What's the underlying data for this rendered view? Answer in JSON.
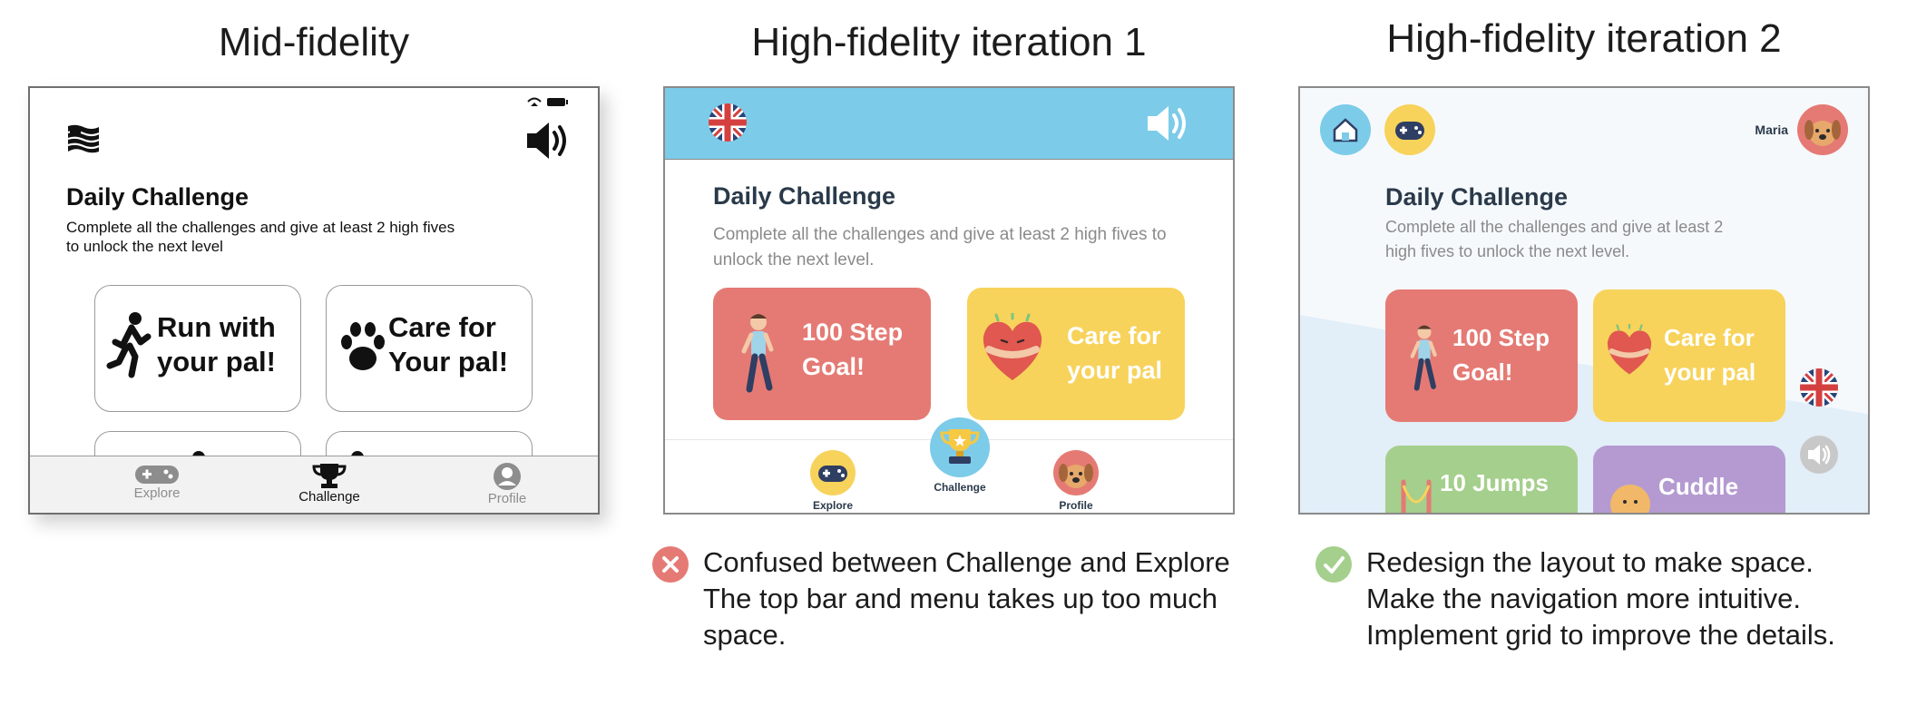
{
  "titles": {
    "mid": "Mid-fidelity",
    "hf1": "High-fidelity iteration 1",
    "hf2": "High-fidelity iteration 2"
  },
  "mid": {
    "heading": "Daily Challenge",
    "description": "Complete all the challenges and give at least 2 high fives to unlock the next level",
    "cards": [
      {
        "label": "Run with your pal!",
        "icon": "running-person-icon"
      },
      {
        "label": "Care for Your pal!",
        "icon": "paw-icon"
      }
    ],
    "nav": [
      {
        "label": "Explore",
        "icon": "gamepad-icon",
        "active": false
      },
      {
        "label": "Challenge",
        "icon": "trophy-icon",
        "active": true
      },
      {
        "label": "Profile",
        "icon": "user-icon",
        "active": false
      }
    ]
  },
  "hf1": {
    "heading": "Daily Challenge",
    "description": "Complete all the challenges and give at least 2 high fives to unlock the next level.",
    "cards": [
      {
        "label": "100 Step Goal!",
        "color": "#e57a74",
        "icon": "boy-walking-icon"
      },
      {
        "label": "Care for your pal",
        "color": "#f7d35b",
        "icon": "heart-hug-icon"
      }
    ],
    "nav": [
      {
        "label": "Explore",
        "icon": "gamepad-icon"
      },
      {
        "label": "Challenge",
        "icon": "trophy-icon"
      },
      {
        "label": "Profile",
        "icon": "dog-avatar-icon"
      }
    ],
    "colors": {
      "topbar": "#7ccbe9"
    }
  },
  "hf2": {
    "user_name": "Maria",
    "heading": "Daily Challenge",
    "description": "Complete all the challenges and give at least 2 high fives to unlock the next level.",
    "cards": [
      {
        "label": "100 Step Goal!",
        "color": "#e57a74",
        "icon": "boy-walking-icon"
      },
      {
        "label": "Care for your pal",
        "color": "#f7d35b",
        "icon": "heart-hug-icon"
      },
      {
        "label": "10 Jumps",
        "color": "#a5cf8c",
        "icon": "jump-rope-icon"
      },
      {
        "label": "Cuddle",
        "color": "#b49ad1",
        "icon": "dog-icon"
      }
    ]
  },
  "notes": {
    "hf1": {
      "status": "negative",
      "lines": [
        "Confused between Challenge and Explore",
        "The top bar and menu takes up too much",
        "space."
      ]
    },
    "hf2": {
      "status": "positive",
      "lines": [
        "Redesign the layout to make space.",
        "Make the navigation more intuitive.",
        "Implement grid to improve the details."
      ]
    }
  }
}
